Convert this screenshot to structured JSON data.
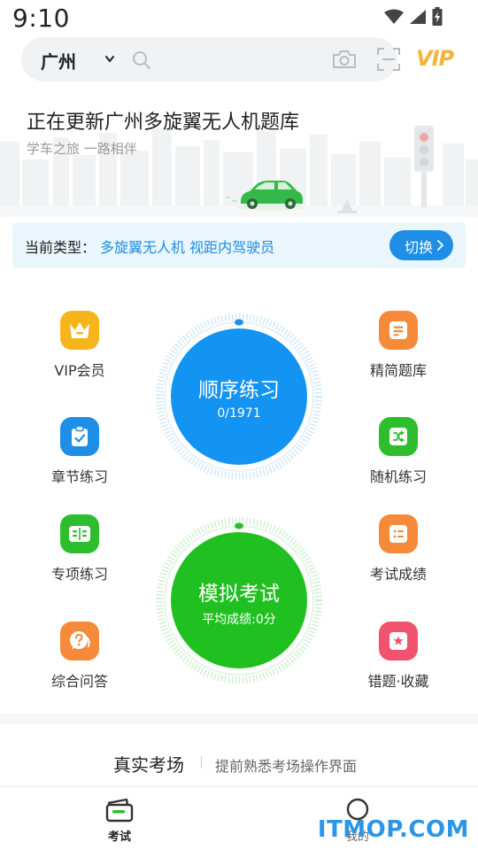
{
  "status_bar": {
    "time": "9:10"
  },
  "search": {
    "city": "广州",
    "vip_label": "VIP"
  },
  "banner": {
    "title": "正在更新广州多旋翼无人机题库",
    "subtitle": "学车之旅 一路相伴"
  },
  "type_bar": {
    "label": "当前类型：",
    "value": "多旋翼无人机 视距内驾驶员",
    "switch_label": "切换"
  },
  "grid": {
    "vip": "VIP会员",
    "chapter": "章节练习",
    "special": "专项练习",
    "qa": "综合问答",
    "concise": "精简题库",
    "random": "随机练习",
    "score": "考试成绩",
    "wrong": "错题·收藏"
  },
  "practice_circle": {
    "title": "顺序练习",
    "progress": "0/1971"
  },
  "exam_circle": {
    "title": "模拟考试",
    "avg": "平均成绩:0分"
  },
  "real_exam": {
    "title": "真实考场",
    "subtitle": "提前熟悉考场操作界面"
  },
  "tabs": [
    {
      "label": "考试",
      "active": true
    },
    {
      "label": "我的",
      "active": false
    }
  ],
  "watermark": "ITMOP.COM",
  "colors": {
    "blue": "#1e8ee6",
    "green": "#2dbd2d",
    "yellow": "#f7b51d",
    "orange": "#f58a3a",
    "red": "#f0536d",
    "light_blue_bg": "#eaf5fc"
  }
}
